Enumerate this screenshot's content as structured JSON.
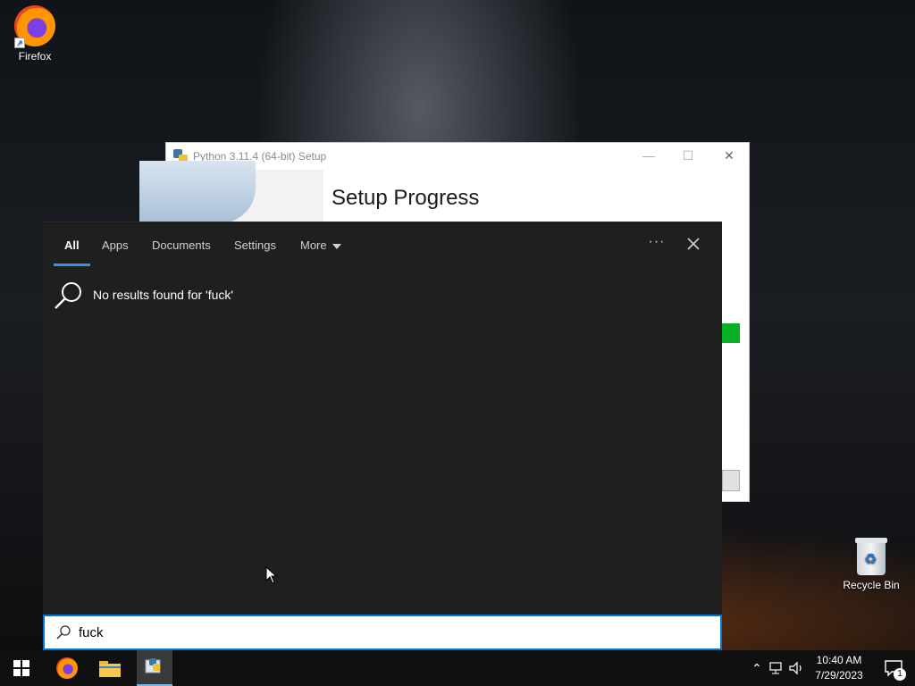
{
  "desktop": {
    "icons": [
      {
        "label": "Firefox"
      },
      {
        "label": "Recycle Bin"
      }
    ]
  },
  "setup_window": {
    "title": "Python 3.11.4 (64-bit) Setup",
    "heading": "Setup Progress",
    "progress_color": "#06b025"
  },
  "search": {
    "tabs": [
      {
        "label": "All",
        "active": true
      },
      {
        "label": "Apps"
      },
      {
        "label": "Documents"
      },
      {
        "label": "Settings"
      },
      {
        "label": "More"
      }
    ],
    "more_options_label": "···",
    "no_results_text": "No results found for 'fuck'",
    "query": "fuck",
    "accent_color": "#0078d7"
  },
  "taskbar": {
    "apps": [
      "start-icon",
      "firefox-icon",
      "file-explorer-icon",
      "python-setup-icon"
    ],
    "clock_time": "10:40 AM",
    "clock_date": "7/29/2023",
    "notification_count": "1"
  }
}
